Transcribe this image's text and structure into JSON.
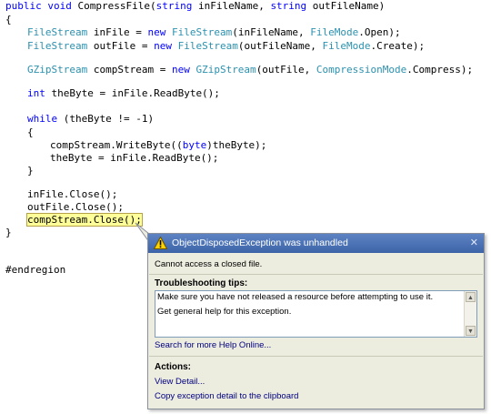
{
  "code": {
    "l1": [
      "public",
      " ",
      "void",
      " CompressFile(",
      "string",
      " inFileName, ",
      "string",
      " outFileName)"
    ],
    "open_brace": "{",
    "l3": [
      "FileStream",
      " inFile = ",
      "new",
      " ",
      "FileStream",
      "(inFileName, ",
      "FileMode",
      ".Open);"
    ],
    "l4": [
      "FileStream",
      " outFile = ",
      "new",
      " ",
      "FileStream",
      "(outFileName, ",
      "FileMode",
      ".Create);"
    ],
    "l6": [
      "GZipStream",
      " compStream = ",
      "new",
      " ",
      "GZipStream",
      "(outFile, ",
      "CompressionMode",
      ".Compress);"
    ],
    "l8": [
      "int",
      " theByte = inFile.ReadByte();"
    ],
    "l10": [
      "while",
      " (theByte != -1)"
    ],
    "l11": "{",
    "l12": [
      "compStream.WriteByte((",
      "byte",
      ")theByte);"
    ],
    "l13": "theByte = inFile.ReadByte();",
    "l14": "}",
    "l16": "inFile.Close();",
    "l17": "outFile.Close();",
    "l18": "compStream.Close();",
    "close_brace": "}",
    "endregion": "#endregion"
  },
  "dialog": {
    "title": "ObjectDisposedException was unhandled",
    "close_glyph": "✕",
    "message": "Cannot access a closed file.",
    "tips_heading": "Troubleshooting tips:",
    "tips": [
      "Make sure you have not released a resource before attempting to use it.",
      "Get general help for this exception."
    ],
    "search_link": "Search for more Help Online...",
    "actions_heading": "Actions:",
    "action_view": "View Detail...",
    "action_copy": "Copy exception detail to the clipboard"
  },
  "colors": {
    "keyword": "#0000ff",
    "type": "#2b91af",
    "highlight": "#ffff99",
    "title_bar": "#3d64a8"
  },
  "icons": {
    "warning": "warning-icon",
    "close": "close-icon",
    "scroll_up": "scroll-up-icon",
    "scroll_down": "scroll-down-icon"
  }
}
